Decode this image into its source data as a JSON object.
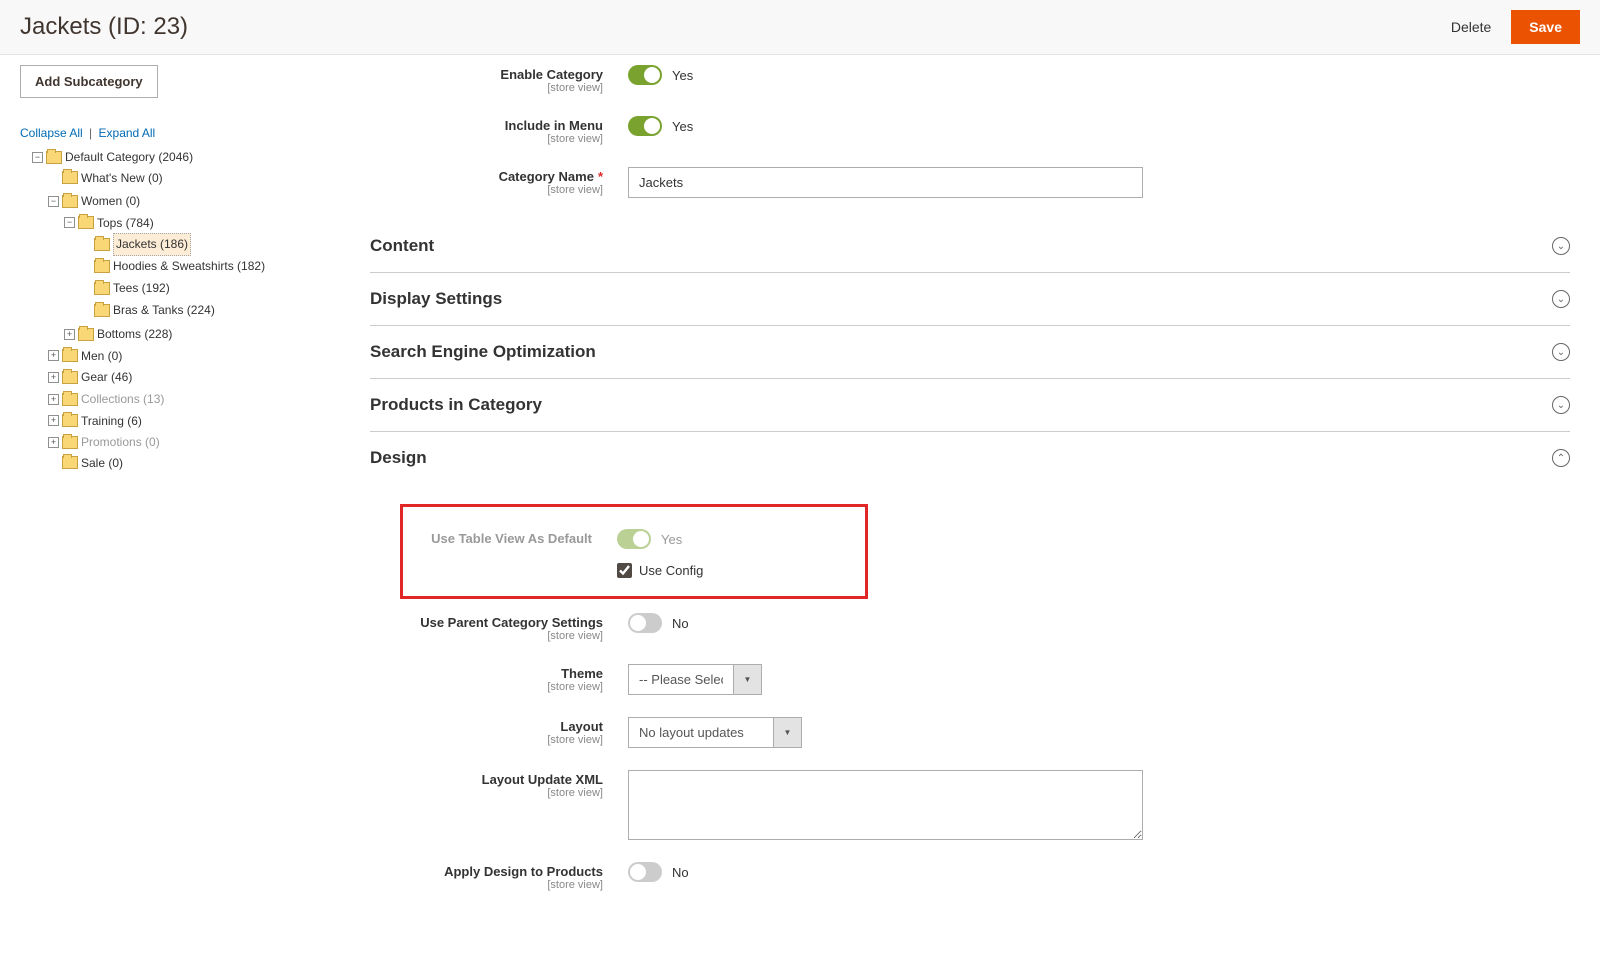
{
  "header": {
    "title": "Jackets (ID: 23)",
    "delete": "Delete",
    "save": "Save"
  },
  "sidebar": {
    "add_subcategory": "Add Subcategory",
    "collapse_all": "Collapse All",
    "expand_all": "Expand All",
    "tree": {
      "default_category": "Default Category (2046)",
      "whats_new": "What's New (0)",
      "women": "Women (0)",
      "tops": "Tops (784)",
      "jackets": "Jackets (186)",
      "hoodies": "Hoodies & Sweatshirts (182)",
      "tees": "Tees (192)",
      "bras": "Bras & Tanks (224)",
      "bottoms": "Bottoms (228)",
      "men": "Men (0)",
      "gear": "Gear (46)",
      "collections": "Collections (13)",
      "training": "Training (6)",
      "promotions": "Promotions (0)",
      "sale": "Sale (0)"
    }
  },
  "form": {
    "enable_category": {
      "label": "Enable Category",
      "scope": "[store view]",
      "value": "Yes"
    },
    "include_in_menu": {
      "label": "Include in Menu",
      "scope": "[store view]",
      "value": "Yes"
    },
    "category_name": {
      "label": "Category Name",
      "scope": "[store view]",
      "value": "Jackets"
    },
    "use_table_view": {
      "label": "Use Table View As Default",
      "value": "Yes",
      "use_config": "Use Config"
    },
    "use_parent": {
      "label": "Use Parent Category Settings",
      "scope": "[store view]",
      "value": "No"
    },
    "theme": {
      "label": "Theme",
      "scope": "[store view]",
      "value": "-- Please Select --"
    },
    "layout": {
      "label": "Layout",
      "scope": "[store view]",
      "value": "No layout updates"
    },
    "layout_xml": {
      "label": "Layout Update XML",
      "scope": "[store view]",
      "value": ""
    },
    "apply_design": {
      "label": "Apply Design to Products",
      "scope": "[store view]",
      "value": "No"
    }
  },
  "sections": {
    "content": "Content",
    "display_settings": "Display Settings",
    "seo": "Search Engine Optimization",
    "products": "Products in Category",
    "design": "Design"
  }
}
